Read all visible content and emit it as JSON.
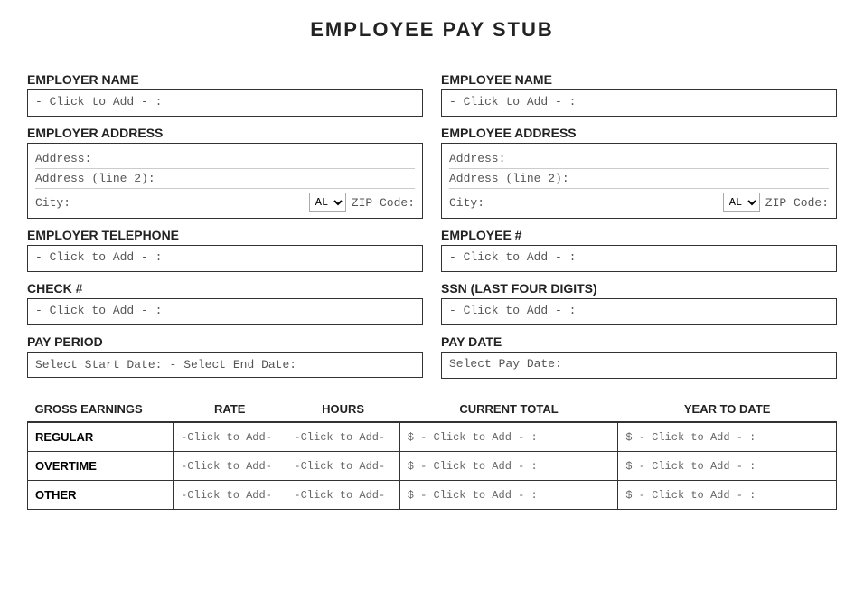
{
  "title": "EMPLOYEE PAY STUB",
  "left": {
    "employer_name_label": "EMPLOYER NAME",
    "employer_name_placeholder": "- Click to Add - :",
    "employer_address_label": "EMPLOYER ADDRESS",
    "address_line1": "Address:",
    "address_line2": "Address (line 2):",
    "city_label": "City:",
    "state_default": "AL",
    "zip_label": "ZIP Code:",
    "employer_telephone_label": "EMPLOYER TELEPHONE",
    "employer_telephone_placeholder": "- Click to Add - :",
    "check_label": "CHECK #",
    "check_placeholder": "- Click to Add - :",
    "pay_period_label": "PAY PERIOD",
    "pay_period_start": "Select Start Date:",
    "pay_period_end": "Select End Date:"
  },
  "right": {
    "employee_name_label": "EMPLOYEE NAME",
    "employee_name_placeholder": "- Click to Add - :",
    "employee_address_label": "EMPLOYEE ADDRESS",
    "address_line1": "Address:",
    "address_line2": "Address (line 2):",
    "city_label": "City:",
    "state_default": "AL",
    "zip_label": "ZIP Code:",
    "employee_num_label": "EMPLOYEE #",
    "employee_num_placeholder": "- Click to Add - :",
    "ssn_label": "SSN (LAST FOUR DIGITS)",
    "ssn_placeholder": "- Click to Add - :",
    "pay_date_label": "PAY DATE",
    "pay_date_placeholder": "Select Pay Date:"
  },
  "earnings": {
    "col_earnings": "GROSS EARNINGS",
    "col_rate": "RATE",
    "col_hours": "HOURS",
    "col_current": "CURRENT TOTAL",
    "col_ytd": "YEAR TO DATE",
    "rows": [
      {
        "label": "REGULAR",
        "rate": "-Click to Add-",
        "hours": "-Click to Add-",
        "current": "$ - Click to Add - :",
        "ytd": "$ - Click to Add - :"
      },
      {
        "label": "OVERTIME",
        "rate": "-Click to Add-",
        "hours": "-Click to Add-",
        "current": "$ - Click to Add - :",
        "ytd": "$ - Click to Add - :"
      },
      {
        "label": "OTHER",
        "rate": "-Click to Add-",
        "hours": "-Click to Add-",
        "current": "$ - Click to Add - :",
        "ytd": "$ - Click to Add - :"
      }
    ]
  }
}
